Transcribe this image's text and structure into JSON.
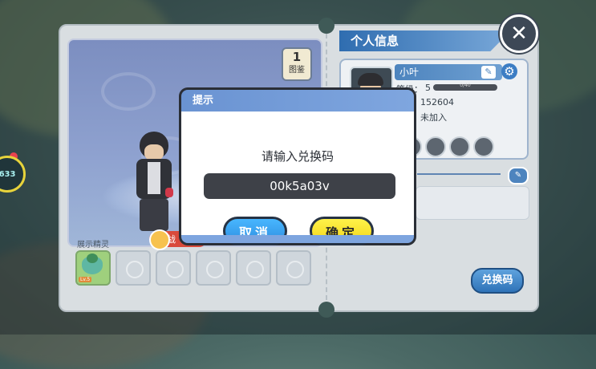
{
  "left_panel": {
    "dex_number": "1",
    "dex_label": "图鉴",
    "battle_tag": "战",
    "display_label": "展示精灵",
    "first_slot_level": "Lv.5"
  },
  "side_badge": "633",
  "right_panel": {
    "header": "个人信息",
    "player_name": "小叶",
    "level_label": "等级：",
    "level_value": "5",
    "xp_text": "0/40",
    "id_value": "152604",
    "guild_value": "未加入",
    "redeem_button": "兑换码",
    "close_glyph": "✕",
    "edit_glyph": "✎",
    "gear_glyph": "⚙"
  },
  "modal": {
    "title": "提示",
    "prompt": "请输入兑换码",
    "code_value": "00k5a03v",
    "cancel_label": "取消",
    "confirm_label": "确定"
  },
  "colors": {
    "modal_header": "#6a93d2",
    "cancel_button": "#2e8fe0",
    "confirm_button": "#f3d719"
  }
}
